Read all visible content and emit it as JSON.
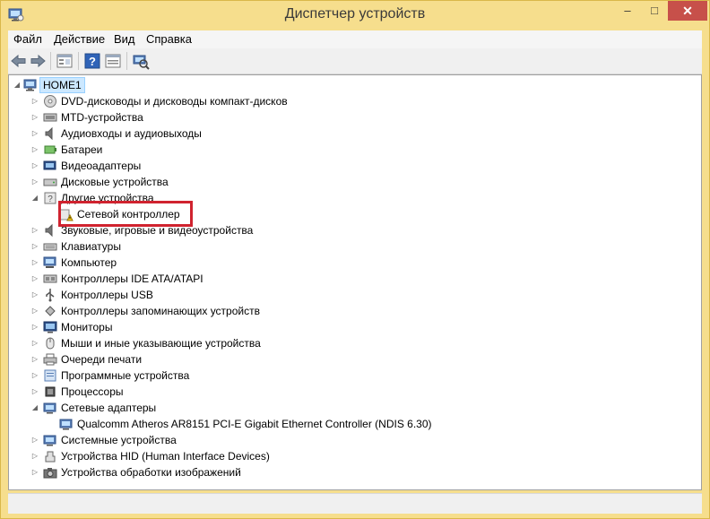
{
  "window": {
    "title": "Диспетчер устройств"
  },
  "menu": [
    {
      "label": "Файл"
    },
    {
      "label": "Действие"
    },
    {
      "label": "Вид"
    },
    {
      "label": "Справка"
    }
  ],
  "toolbar": [
    {
      "name": "back-icon"
    },
    {
      "name": "forward-icon"
    },
    {
      "name": "properties-icon"
    },
    {
      "name": "help-icon"
    },
    {
      "name": "details-icon"
    },
    {
      "name": "scan-hardware-icon"
    }
  ],
  "tree": {
    "root": {
      "label": "HOME1",
      "icon": "computer-icon"
    },
    "items": [
      {
        "label": "DVD-дисководы и дисководы компакт-дисков",
        "icon": "dvd-drive-icon",
        "state": "collapsed"
      },
      {
        "label": "MTD-устройства",
        "icon": "memory-device-icon",
        "state": "collapsed"
      },
      {
        "label": "Аудиовходы и аудиовыходы",
        "icon": "audio-icon",
        "state": "collapsed"
      },
      {
        "label": "Батареи",
        "icon": "battery-icon",
        "state": "collapsed"
      },
      {
        "label": "Видеоадаптеры",
        "icon": "display-adapter-icon",
        "state": "collapsed"
      },
      {
        "label": "Дисковые устройства",
        "icon": "disk-drive-icon",
        "state": "collapsed"
      },
      {
        "label": "Другие устройства",
        "icon": "other-devices-icon",
        "state": "expanded"
      },
      {
        "label": "Сетевой контроллер",
        "icon": "warning-device-icon",
        "state": "child",
        "highlighted": true
      },
      {
        "label": "Звуковые, игровые и видеоустройства",
        "icon": "sound-icon",
        "state": "collapsed"
      },
      {
        "label": "Клавиатуры",
        "icon": "keyboard-icon",
        "state": "collapsed"
      },
      {
        "label": "Компьютер",
        "icon": "computer-icon",
        "state": "collapsed"
      },
      {
        "label": "Контроллеры IDE ATA/ATAPI",
        "icon": "ide-controller-icon",
        "state": "collapsed"
      },
      {
        "label": "Контроллеры USB",
        "icon": "usb-icon",
        "state": "collapsed"
      },
      {
        "label": "Контроллеры запоминающих устройств",
        "icon": "storage-controller-icon",
        "state": "collapsed"
      },
      {
        "label": "Мониторы",
        "icon": "monitor-icon",
        "state": "collapsed"
      },
      {
        "label": "Мыши и иные указывающие устройства",
        "icon": "mouse-icon",
        "state": "collapsed"
      },
      {
        "label": "Очереди печати",
        "icon": "printer-icon",
        "state": "collapsed"
      },
      {
        "label": "Программные устройства",
        "icon": "software-device-icon",
        "state": "collapsed"
      },
      {
        "label": "Процессоры",
        "icon": "processor-icon",
        "state": "collapsed"
      },
      {
        "label": "Сетевые адаптеры",
        "icon": "network-adapter-icon",
        "state": "expanded"
      },
      {
        "label": "Qualcomm Atheros AR8151 PCI-E Gigabit Ethernet Controller (NDIS 6.30)",
        "icon": "network-card-icon",
        "state": "child"
      },
      {
        "label": "Системные устройства",
        "icon": "system-device-icon",
        "state": "collapsed"
      },
      {
        "label": "Устройства HID (Human Interface Devices)",
        "icon": "hid-icon",
        "state": "collapsed"
      },
      {
        "label": "Устройства обработки изображений",
        "icon": "camera-icon",
        "state": "collapsed"
      }
    ]
  },
  "colors": {
    "frame": "#f6de8d",
    "highlight_border": "#d0232f",
    "close_button": "#c7504a",
    "root_selection": "#cce8ff"
  }
}
